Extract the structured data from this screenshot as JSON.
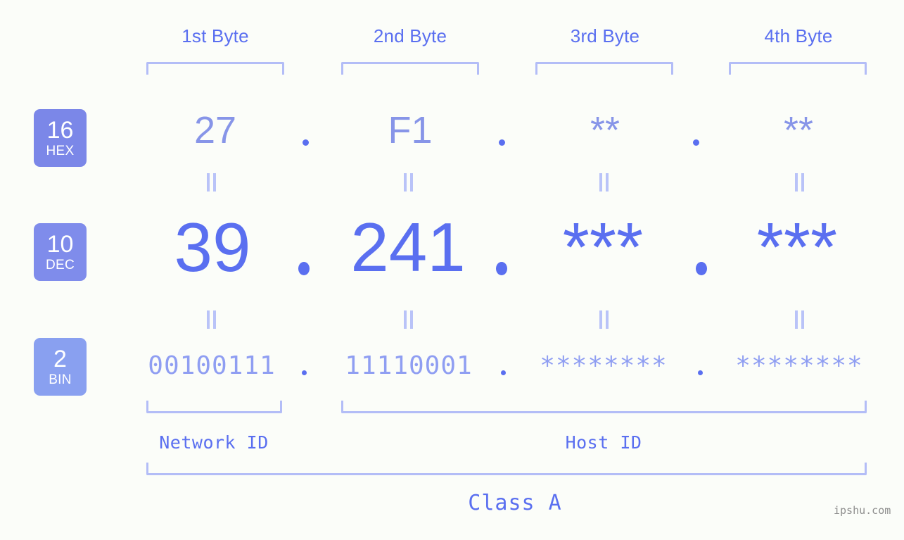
{
  "meta": {
    "background_color": "#fbfdf9",
    "accent_light": "#8f9ef2",
    "accent_medium": "#5a6ff0",
    "bracket_color": "#b3bdf7",
    "watermark": "ipshu.com"
  },
  "byte_headers": [
    {
      "label": "1st Byte"
    },
    {
      "label": "2nd Byte"
    },
    {
      "label": "3rd Byte"
    },
    {
      "label": "4th Byte"
    }
  ],
  "rows": [
    {
      "id": "hex",
      "badge": {
        "base": "16",
        "name": "HEX",
        "color": "#7b87e8"
      },
      "values": [
        "27",
        "F1",
        "**",
        "**"
      ]
    },
    {
      "id": "dec",
      "badge": {
        "base": "10",
        "name": "DEC",
        "color": "#7f8ceb"
      },
      "values": [
        "39",
        "241",
        "***",
        "***"
      ]
    },
    {
      "id": "bin",
      "badge": {
        "base": "2",
        "name": "BIN",
        "color": "#89a0f0"
      },
      "values": [
        "00100111",
        "11110001",
        "********",
        "********"
      ]
    }
  ],
  "separator": ".",
  "equals_symbol": "=",
  "id_labels": {
    "network": "Network ID",
    "host": "Host ID"
  },
  "class_label": "Class A",
  "address": {
    "hex": "27.F1.**.**",
    "dec": "39.241.***.***",
    "bin": "00100111.11110001.********.********",
    "class": "A"
  }
}
